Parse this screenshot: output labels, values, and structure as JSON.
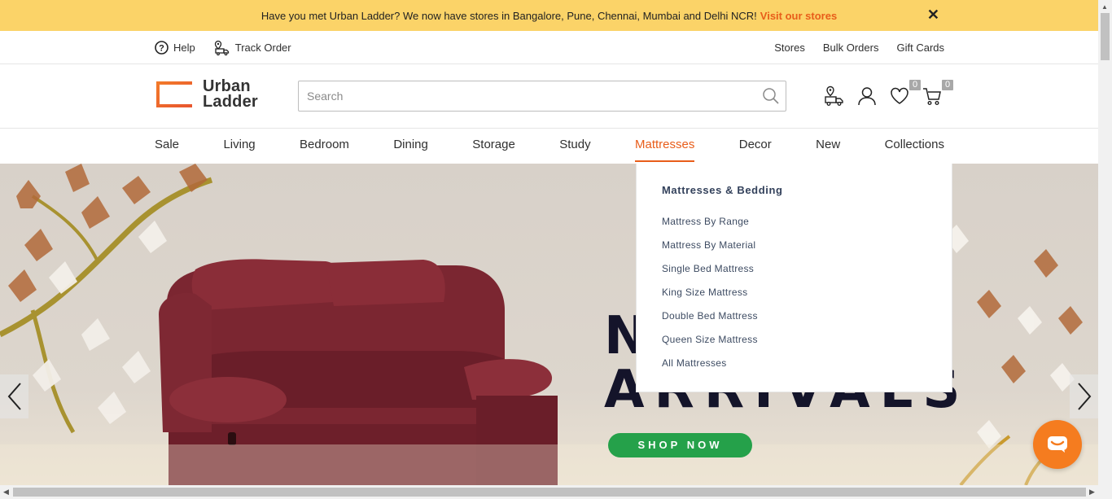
{
  "announcement": {
    "text": "Have you met Urban Ladder? We now have stores in Bangalore, Pune, Chennai, Mumbai and Delhi NCR!",
    "link": "Visit our stores",
    "close": "✕"
  },
  "utility": {
    "help": "Help",
    "track_order": "Track Order",
    "right": [
      "Stores",
      "Bulk Orders",
      "Gift Cards"
    ]
  },
  "brand": {
    "line1": "Urban",
    "line2": "Ladder"
  },
  "search": {
    "placeholder": "Search",
    "value": ""
  },
  "header_icons": {
    "wishlist_count": "0",
    "cart_count": "0"
  },
  "nav": [
    "Sale",
    "Living",
    "Bedroom",
    "Dining",
    "Storage",
    "Study",
    "Mattresses",
    "Decor",
    "New",
    "Collections"
  ],
  "active_nav": "Mattresses",
  "dropdown": {
    "heading": "Mattresses & Bedding",
    "items": [
      "Mattress By Range",
      "Mattress By Material",
      "Single Bed Mattress",
      "King Size Mattress",
      "Double Bed Mattress",
      "Queen Size Mattress",
      "All Mattresses"
    ]
  },
  "hero": {
    "line1": "N",
    "line2": "ARRIVALS",
    "cta": "SHOP NOW"
  },
  "colors": {
    "accent": "#e85d1a",
    "banner": "#fbd368",
    "cta": "#25a14a",
    "chat": "#f57c1f"
  }
}
